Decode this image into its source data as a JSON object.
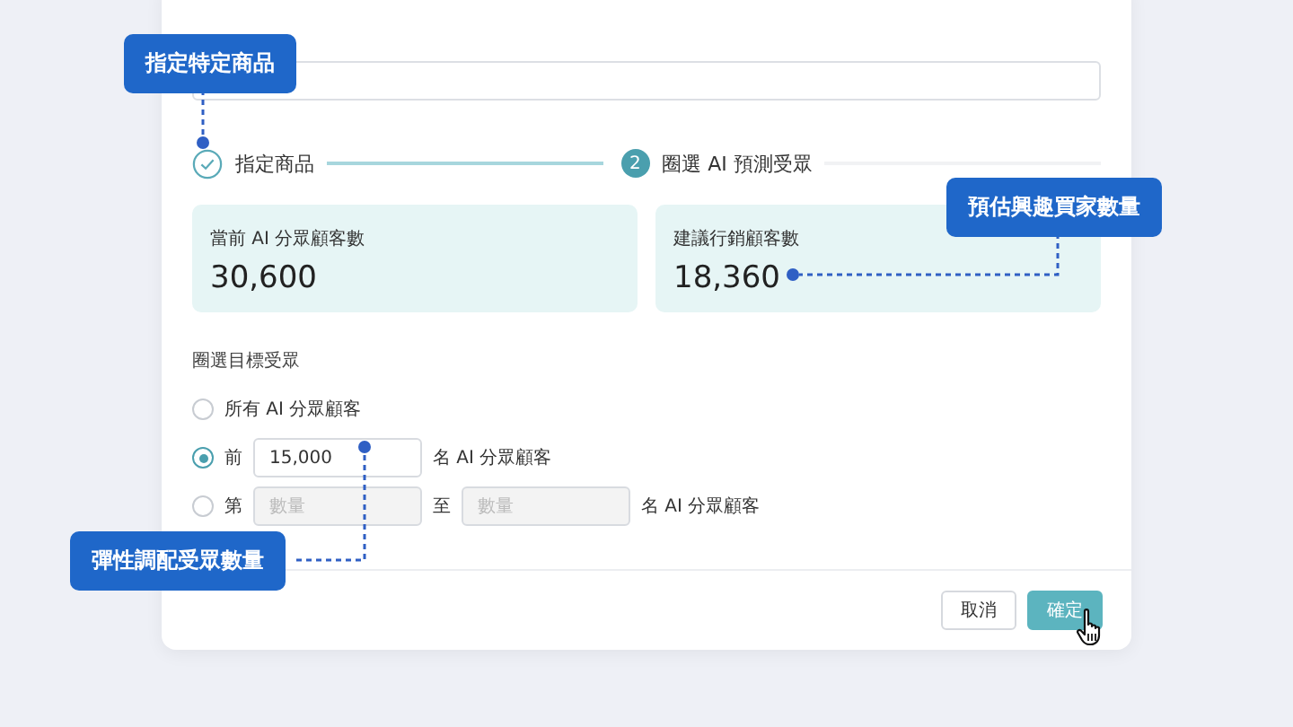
{
  "steps": [
    {
      "label": "指定商品",
      "done": true
    },
    {
      "number": "2",
      "label": "圈選 AI 預測受眾",
      "done": false
    }
  ],
  "cards": [
    {
      "label": "當前 AI 分眾顧客數",
      "value": "30,600"
    },
    {
      "label": "建議行銷顧客數",
      "value": "18,360"
    }
  ],
  "audience": {
    "title": "圈選目標受眾",
    "options": [
      {
        "kind": "all",
        "label": "所有 AI 分眾顧客",
        "selected": false
      },
      {
        "kind": "top",
        "prefix": "前",
        "value": "15,000",
        "suffix": "名 AI 分眾顧客",
        "selected": true
      },
      {
        "kind": "range",
        "prefix": "第",
        "from_placeholder": "數量",
        "middle": "至",
        "to_placeholder": "數量",
        "suffix": "名 AI 分眾顧客",
        "selected": false
      }
    ]
  },
  "buttons": [
    {
      "label": "取消",
      "primary": false
    },
    {
      "label": "確定",
      "primary": true
    }
  ],
  "callouts": [
    {
      "text": "指定特定商品"
    },
    {
      "text": "預估興趣買家數量"
    },
    {
      "text": "彈性調配受眾數量"
    }
  ]
}
